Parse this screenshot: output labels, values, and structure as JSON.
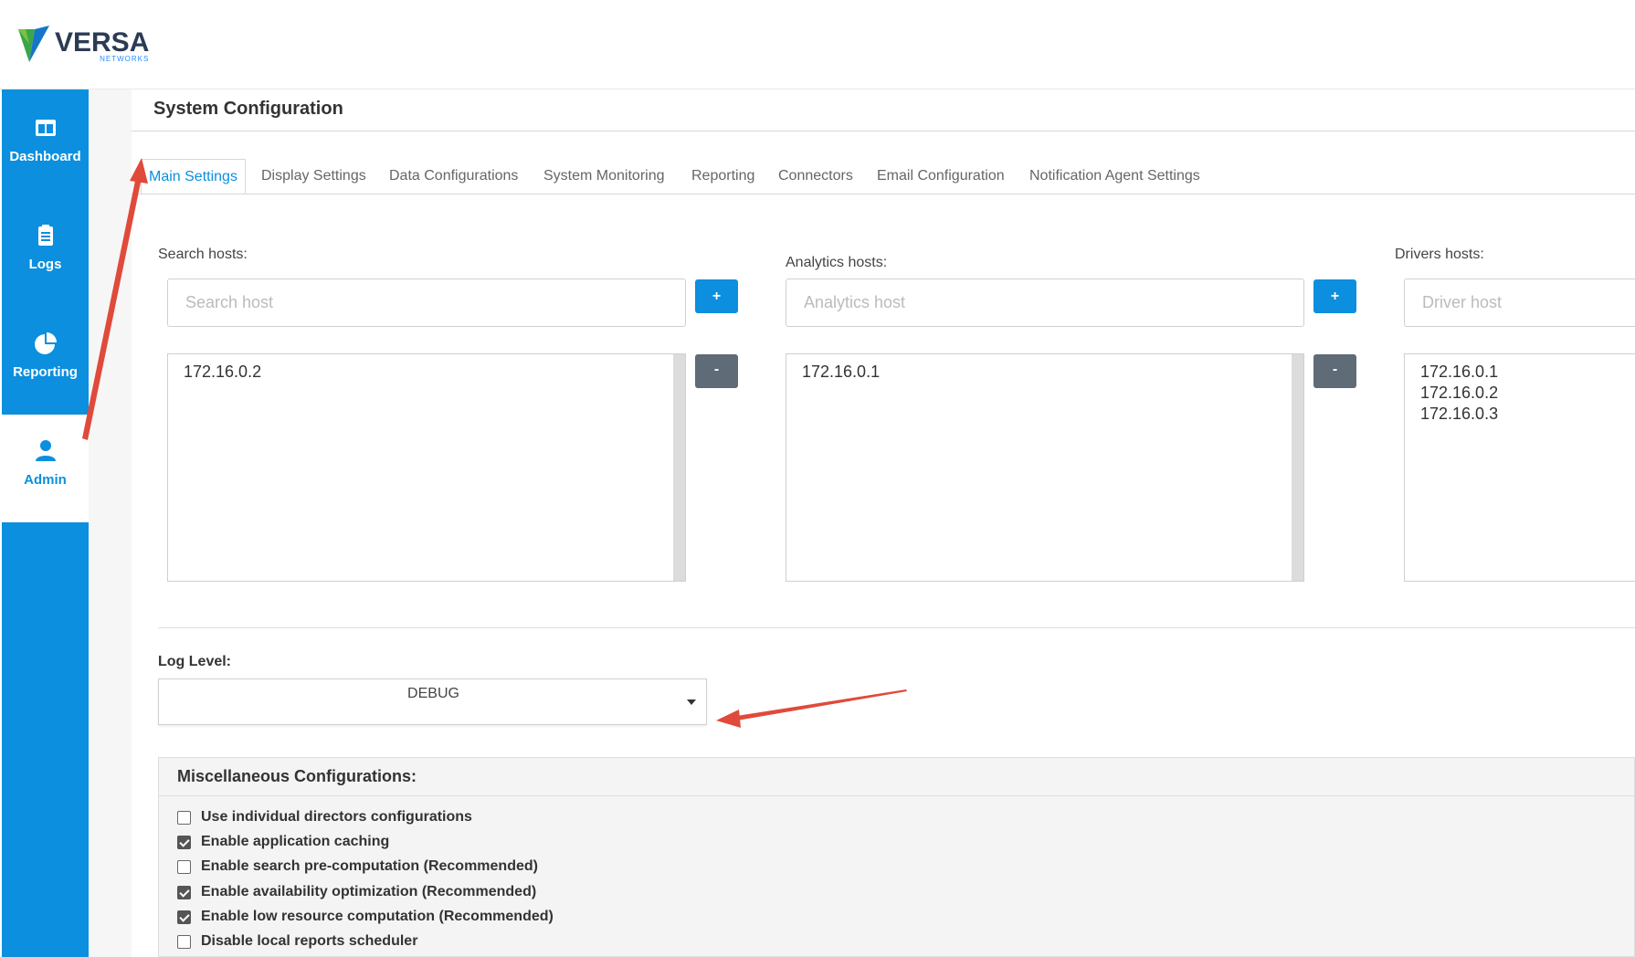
{
  "brand": {
    "name": "VERSA",
    "subtitle": "NETWORKS"
  },
  "sidebar": {
    "items": [
      {
        "label": "Dashboard",
        "icon": "dashboard-icon",
        "active": false
      },
      {
        "label": "Logs",
        "icon": "clipboard-icon",
        "active": false
      },
      {
        "label": "Reporting",
        "icon": "pie-chart-icon",
        "active": false
      },
      {
        "label": "Admin",
        "icon": "user-icon",
        "active": true
      }
    ]
  },
  "page": {
    "title": "System Configuration"
  },
  "tabs": [
    {
      "label": "Main Settings",
      "active": true
    },
    {
      "label": "Display Settings"
    },
    {
      "label": "Data Configurations"
    },
    {
      "label": "System Monitoring"
    },
    {
      "label": "Reporting"
    },
    {
      "label": "Connectors"
    },
    {
      "label": "Email Configuration"
    },
    {
      "label": "Notification Agent Settings"
    }
  ],
  "hosts": {
    "search": {
      "label": "Search hosts:",
      "placeholder": "Search host",
      "add": "+",
      "remove": "-",
      "entries": [
        "172.16.0.2"
      ]
    },
    "analytics": {
      "label": "Analytics hosts:",
      "placeholder": "Analytics host",
      "add": "+",
      "remove": "-",
      "entries": [
        "172.16.0.1"
      ]
    },
    "drivers": {
      "label": "Drivers hosts:",
      "placeholder": "Driver host",
      "entries": [
        "172.16.0.1",
        "172.16.0.2",
        "172.16.0.3"
      ]
    }
  },
  "log_level": {
    "label": "Log Level:",
    "value": "DEBUG"
  },
  "misc": {
    "title": "Miscellaneous Configurations:",
    "options": [
      {
        "label": "Use individual directors configurations",
        "checked": false
      },
      {
        "label": "Enable application caching",
        "checked": true
      },
      {
        "label": "Enable search pre-computation (Recommended)",
        "checked": false
      },
      {
        "label": "Enable availability optimization (Recommended)",
        "checked": true
      },
      {
        "label": "Enable low resource computation (Recommended)",
        "checked": true
      },
      {
        "label": "Disable local reports scheduler",
        "checked": false
      }
    ]
  },
  "colors": {
    "accent": "#0b8fde",
    "annotation": "#e04a3a",
    "button_secondary": "#5f6b77"
  }
}
